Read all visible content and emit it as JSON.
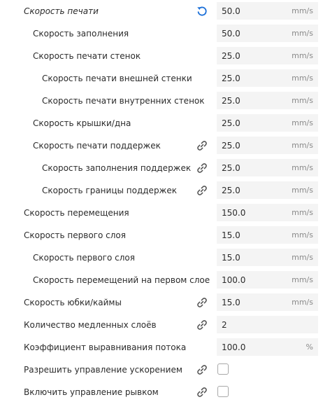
{
  "settings": {
    "rows": [
      {
        "label": "Скорость печати",
        "value": "50.0",
        "unit": "mm/s",
        "icon": "reset-icon"
      },
      {
        "label": "Скорость заполнения",
        "value": "50.0",
        "unit": "mm/s"
      },
      {
        "label": "Скорость печати стенок",
        "value": "25.0",
        "unit": "mm/s"
      },
      {
        "label": "Скорость печати внешней стенки",
        "value": "25.0",
        "unit": "mm/s"
      },
      {
        "label": "Скорость печати внутренних стенок",
        "value": "25.0",
        "unit": "mm/s"
      },
      {
        "label": "Скорость крышки/дна",
        "value": "25.0",
        "unit": "mm/s"
      },
      {
        "label": "Скорость печати поддержек",
        "value": "25.0",
        "unit": "mm/s",
        "icon": "link-icon"
      },
      {
        "label": "Скорость заполнения поддержек",
        "value": "25.0",
        "unit": "mm/s",
        "icon": "link-icon"
      },
      {
        "label": "Скорость границы поддержек",
        "value": "25.0",
        "unit": "mm/s",
        "icon": "link-icon"
      },
      {
        "label": "Скорость перемещения",
        "value": "150.0",
        "unit": "mm/s"
      },
      {
        "label": "Скорость первого слоя",
        "value": "15.0",
        "unit": "mm/s"
      },
      {
        "label": "Скорость первого слоя",
        "value": "15.0",
        "unit": "mm/s"
      },
      {
        "label": "Скорость перемещений на первом слое",
        "value": "100.0",
        "unit": "mm/s"
      },
      {
        "label": "Скорость юбки/каймы",
        "value": "15.0",
        "unit": "mm/s",
        "icon": "link-icon"
      },
      {
        "label": "Количество медленных слоёв",
        "value": "2",
        "unit": "",
        "icon": "link-icon"
      },
      {
        "label": "Коэффициент выравнивания потока",
        "value": "100.0",
        "unit": "%"
      },
      {
        "label": "Разрешить управление ускорением",
        "checked": false,
        "icon": "link-icon"
      },
      {
        "label": "Включить управление рывком",
        "checked": false,
        "icon": "link-icon"
      }
    ]
  },
  "colors": {
    "reset_icon": "#1b6fd8",
    "link_icon": "#555555",
    "field_bg": "#f4f4f4"
  }
}
